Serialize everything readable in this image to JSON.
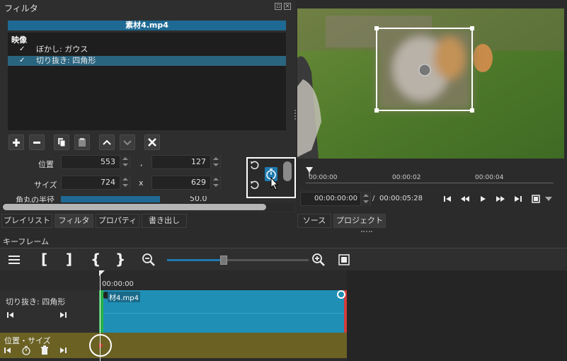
{
  "filter_panel": {
    "title": "フィルタ",
    "clip_name": "素材4.mp4",
    "list_header": "映像",
    "filters": [
      {
        "check": "✓",
        "label": "ぼかし: ガウス",
        "selected": false
      },
      {
        "check": "✓",
        "label": "切り抜き: 四角形",
        "selected": true
      }
    ],
    "toolbar_icons": [
      "add-icon",
      "remove-icon",
      "copy-icon",
      "paste-icon",
      "move-up-icon",
      "move-down-icon",
      "deselect-icon"
    ],
    "params": {
      "position_label": "位置",
      "position_x": "553",
      "position_sep": ",",
      "position_y": "127",
      "size_label": "サイズ",
      "size_w": "724",
      "size_sep": "x",
      "size_h": "629",
      "radius_label": "角丸の半径",
      "radius_value": "50.0"
    }
  },
  "panel_tabs": [
    "プレイリスト",
    "フィルタ",
    "プロパティ",
    "書き出し"
  ],
  "player": {
    "ruler_labels": [
      "00:00:00",
      "00:00:02",
      "00:00:04"
    ],
    "current_time": "00:00:00:00",
    "time_separator": "/",
    "total_time": "00:00:05:28",
    "tabs": [
      "ソース",
      "プロジェクト"
    ]
  },
  "keyframes": {
    "title": "キーフレーム",
    "ruler_time": "00:00:00",
    "track_clip": "材4.mp4",
    "track_name": "切り抜き: 四角形",
    "param_name": "位置・サイズ"
  },
  "colors": {
    "accent": "#1f6a94",
    "clip_blue": "#1f8fb5",
    "keyframe_track": "#6a6123",
    "selection": "#2a6580"
  }
}
